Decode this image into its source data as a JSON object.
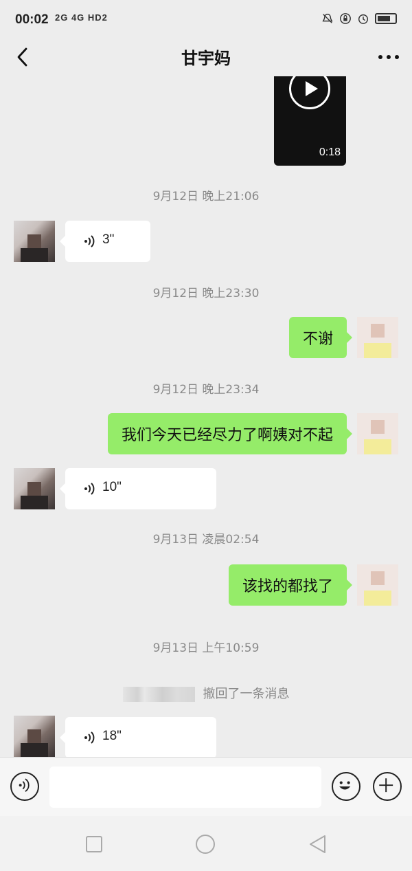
{
  "status_bar": {
    "time": "00:02",
    "network": "2G 4G HD2"
  },
  "header": {
    "title": "甘宇妈"
  },
  "messages": {
    "video": {
      "duration": "0:18"
    },
    "ts1": "9月12日 晚上21:06",
    "voice1": "3\"",
    "ts2": "9月12日 晚上23:30",
    "out1": "不谢",
    "ts3": "9月12日 晚上23:34",
    "out2": "我们今天已经尽力了啊姨对不起",
    "voice2": "10\"",
    "ts4": "9月13日 凌晨02:54",
    "out3": "该找的都找了",
    "ts5": "9月13日 上午10:59",
    "recall": "撤回了一条消息",
    "voice3": "18\""
  },
  "input": {
    "placeholder": ""
  },
  "colors": {
    "background": "#ededed",
    "outgoing_bubble": "#95ec69",
    "incoming_bubble": "#ffffff",
    "timestamp": "#8a8a8a"
  },
  "icons": {
    "back": "chevron-left-icon",
    "more": "more-dots-icon",
    "voice_toggle": "voice-mode-icon",
    "emoji": "emoji-icon",
    "plus": "plus-icon"
  }
}
